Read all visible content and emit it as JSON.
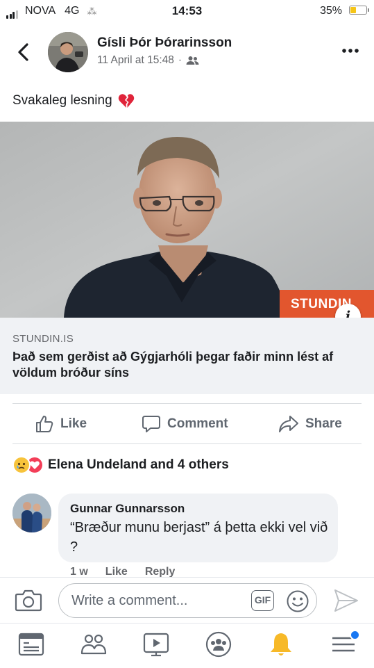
{
  "status_bar": {
    "carrier": "NOVA",
    "network": "4G",
    "time": "14:53",
    "battery_percent": "35%",
    "battery_level": 0.35
  },
  "post": {
    "author": "Gísli Þór Þórarinsson",
    "timestamp": "11 April at 15:48",
    "audience_icon": "friends-icon",
    "text": "Svakaleg lesning",
    "text_emoji": "broken-heart",
    "link": {
      "brand": "STUNDIN",
      "domain": "STUNDIN.IS",
      "headline": "Það sem gerðist að Gýgjarhóli þegar faðir minn lést af völdum bróður síns"
    }
  },
  "actions": {
    "like": "Like",
    "comment": "Comment",
    "share": "Share"
  },
  "reactions": {
    "summary": "Elena Undeland and 4 others",
    "types": [
      "sad",
      "love"
    ]
  },
  "comment": {
    "author": "Gunnar Gunnarsson",
    "text": "“Bræður munu berjast” á þetta ekki vel við ?",
    "age": "1 w",
    "like": "Like",
    "reply": "Reply"
  },
  "composer": {
    "placeholder": "Write a comment...",
    "gif": "GIF"
  },
  "tabs": [
    "news-feed",
    "friends",
    "watch",
    "groups",
    "notifications",
    "menu"
  ],
  "colors": {
    "brand_orange": "#e2562e",
    "accent_blue": "#1877f2",
    "text_gray": "#65676b"
  }
}
